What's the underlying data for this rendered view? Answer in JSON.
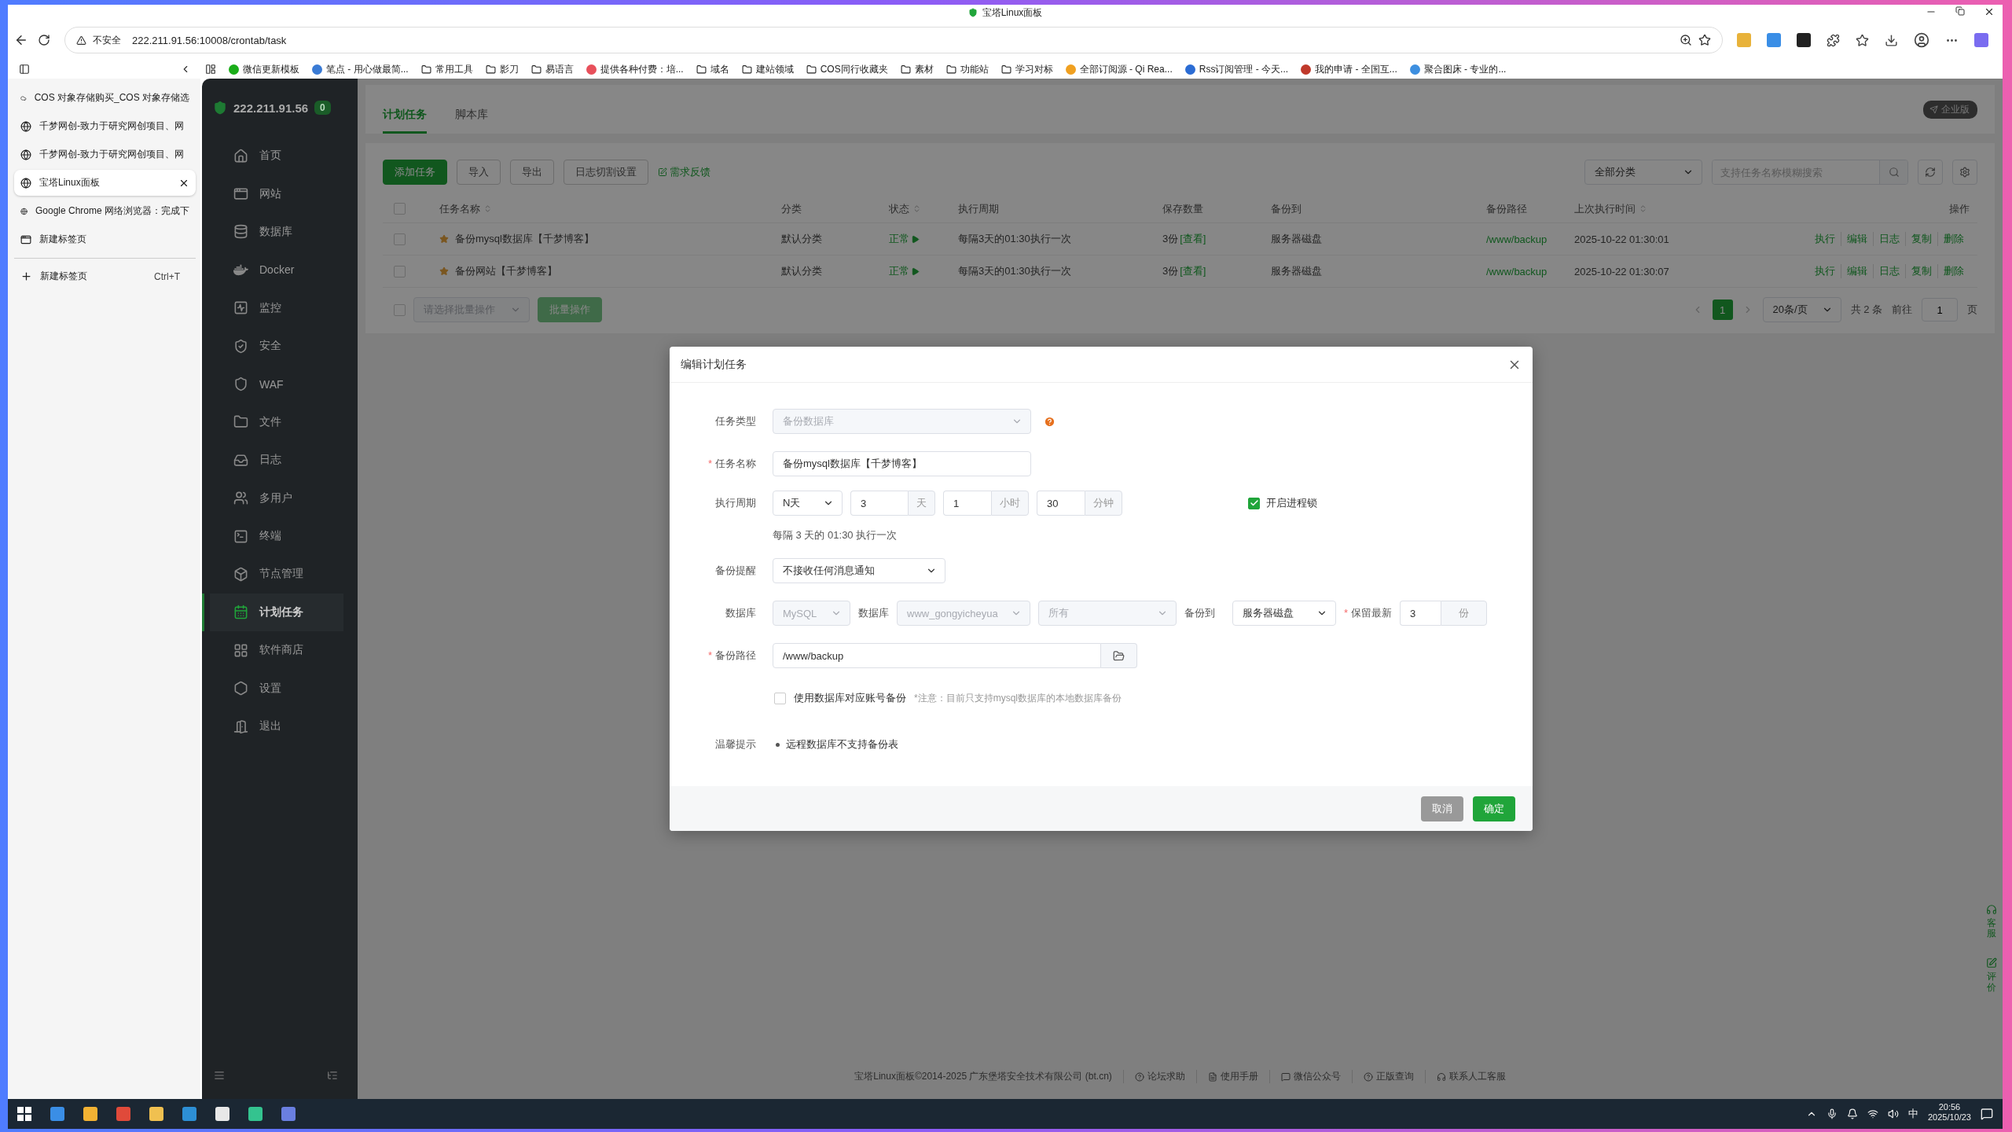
{
  "browser": {
    "title": "宝塔Linux面板",
    "security_label": "不安全",
    "url": "222.211.91.56:10008/crontab/task",
    "bookmarks": [
      {
        "kind": "site",
        "label": "微信更新模板",
        "color": "#1aad19"
      },
      {
        "kind": "site",
        "label": "笔点 - 用心做最简...",
        "color": "#3a7bd5"
      },
      {
        "kind": "folder",
        "label": "常用工具"
      },
      {
        "kind": "folder",
        "label": "影刀"
      },
      {
        "kind": "folder",
        "label": "易语言"
      },
      {
        "kind": "site",
        "label": "提供各种付费：培...",
        "color": "#e8505b"
      },
      {
        "kind": "folder",
        "label": "域名"
      },
      {
        "kind": "folder",
        "label": "建站领域"
      },
      {
        "kind": "folder",
        "label": "COS同行收藏夹"
      },
      {
        "kind": "folder",
        "label": "素材"
      },
      {
        "kind": "folder",
        "label": "功能站"
      },
      {
        "kind": "folder",
        "label": "学习对标"
      },
      {
        "kind": "site",
        "label": "全部订阅源 - Qi Rea...",
        "color": "#f0a020"
      },
      {
        "kind": "site",
        "label": "Rss订阅管理 - 今天...",
        "color": "#2b6cd4"
      },
      {
        "kind": "site",
        "label": "我的申请 - 全国互...",
        "color": "#c0392b"
      },
      {
        "kind": "site",
        "label": "聚合图床 - 专业的...",
        "color": "#3d8fe0"
      }
    ],
    "tabs": [
      {
        "title": "COS 对象存储购买_COS 对象存储选",
        "selected": false
      },
      {
        "title": "千梦网创-致力于研究网创项目、网",
        "selected": false
      },
      {
        "title": "千梦网创-致力于研究网创项目、网",
        "selected": false
      },
      {
        "title": "宝塔Linux面板",
        "selected": true
      },
      {
        "title": "Google Chrome 网络浏览器：完成下",
        "selected": false
      },
      {
        "title": "新建标签页",
        "selected": false
      }
    ],
    "new_tab": {
      "label": "新建标签页",
      "shortcut": "Ctrl+T"
    }
  },
  "panel": {
    "host": "222.211.91.56",
    "alert_count": "0",
    "nav": [
      {
        "label": "首页",
        "selected": false
      },
      {
        "label": "网站",
        "selected": false
      },
      {
        "label": "数据库",
        "selected": false
      },
      {
        "label": "Docker",
        "selected": false
      },
      {
        "label": "监控",
        "selected": false
      },
      {
        "label": "安全",
        "selected": false
      },
      {
        "label": "WAF",
        "selected": false
      },
      {
        "label": "文件",
        "selected": false
      },
      {
        "label": "日志",
        "selected": false
      },
      {
        "label": "多用户",
        "selected": false
      },
      {
        "label": "终端",
        "selected": false
      },
      {
        "label": "节点管理",
        "selected": false
      },
      {
        "label": "计划任务",
        "selected": true
      },
      {
        "label": "软件商店",
        "selected": false
      },
      {
        "label": "设置",
        "selected": false
      },
      {
        "label": "退出",
        "selected": false
      }
    ],
    "page_tabs": [
      {
        "label": "计划任务",
        "selected": true
      },
      {
        "label": "脚本库",
        "selected": false
      }
    ],
    "edition": "企业版",
    "toolbar": {
      "buttons": [
        {
          "kind": "primary",
          "label": "添加任务"
        },
        {
          "kind": "default",
          "label": "导入"
        },
        {
          "kind": "default",
          "label": "导出"
        },
        {
          "kind": "default",
          "label": "日志切割设置"
        }
      ],
      "feedback_link": "需求反馈",
      "category_filter": "全部分类",
      "search": {
        "placeholder": "支持任务名称模糊搜索"
      }
    },
    "table": {
      "select_all_checked": false,
      "columns": [
        {
          "label": "任务名称",
          "sortable": true
        },
        {
          "label": "分类",
          "sortable": false
        },
        {
          "label": "状态",
          "sortable": true
        },
        {
          "label": "执行周期",
          "sortable": false
        },
        {
          "label": "保存数量",
          "sortable": false
        },
        {
          "label": "备份到",
          "sortable": false
        },
        {
          "label": "备份路径",
          "sortable": false
        },
        {
          "label": "上次执行时间",
          "sortable": true
        },
        {
          "label": "操作",
          "sortable": false
        }
      ],
      "rows": [
        {
          "checked": false,
          "starred": true,
          "name": "备份mysql数据库【千梦博客】",
          "category": "默认分类",
          "status": "正常",
          "cycle": "每隔3天的01:30执行一次",
          "count": "3份",
          "count_link": "[查看]",
          "destination": "服务器磁盘",
          "path": "/www/backup",
          "last_run": "2025-10-22 01:30:01",
          "actions": [
            "执行",
            "编辑",
            "日志",
            "复制",
            "删除"
          ]
        },
        {
          "checked": false,
          "starred": true,
          "name": "备份网站【千梦博客】",
          "category": "默认分类",
          "status": "正常",
          "cycle": "每隔3天的01:30执行一次",
          "count": "3份",
          "count_link": "[查看]",
          "destination": "服务器磁盘",
          "path": "/www/backup",
          "last_run": "2025-10-22 01:30:07",
          "actions": [
            "执行",
            "编辑",
            "日志",
            "复制",
            "删除"
          ]
        }
      ]
    },
    "batch": {
      "checked": false,
      "placeholder": "请选择批量操作",
      "button": "批量操作"
    },
    "pagination": {
      "pages": [
        {
          "label": "1",
          "selected": true
        }
      ],
      "page_size": "20条/页",
      "total": "共 2 条",
      "goto_label": "前往",
      "goto_value": "1",
      "goto_suffix": "页"
    },
    "footer": {
      "copyright": "宝塔Linux面板©2014-2025 广东堡塔安全技术有限公司 (bt.cn)",
      "links": [
        "论坛求助",
        "使用手册",
        "微信公众号",
        "正版查询",
        "联系人工客服"
      ]
    },
    "side_float": [
      "客服",
      "评价"
    ]
  },
  "dialog": {
    "title": "编辑计划任务",
    "task_type": {
      "label": "任务类型",
      "value": "备份数据库",
      "disabled": true
    },
    "task_name": {
      "label": "任务名称",
      "required_mark": "*",
      "value": "备份mysql数据库【千梦博客】"
    },
    "schedule": {
      "label": "执行周期",
      "mode": "N天",
      "fields": [
        {
          "value": "3",
          "unit": "天"
        },
        {
          "value": "1",
          "unit": "小时"
        },
        {
          "value": "30",
          "unit": "分钟"
        }
      ],
      "lock": {
        "label": "开启进程锁",
        "checked": true
      },
      "summary": "每隔 3 天的 01:30 执行一次"
    },
    "notify": {
      "label": "备份提醒",
      "value": "不接收任何消息通知"
    },
    "database": {
      "label": "数据库",
      "engine": {
        "value": "MySQL",
        "disabled": true
      },
      "db_label": "数据库",
      "db": {
        "value": "www_gongyicheyua",
        "disabled": true
      },
      "tables": {
        "value": "所有",
        "disabled": true
      },
      "target_label": "备份到",
      "target": {
        "value": "服务器磁盘",
        "disabled": false
      },
      "keep_label": "保留最新",
      "keep_mark": "*",
      "keep": {
        "value": "3",
        "unit": "份"
      }
    },
    "path": {
      "label": "备份路径",
      "required_mark": "*",
      "value": "/www/backup"
    },
    "account_backup": {
      "label": "使用数据库对应账号备份",
      "checked": false,
      "note": "*注意：目前只支持mysql数据库的本地数据库备份"
    },
    "tips": {
      "label": "温馨提示",
      "items": [
        "远程数据库不支持备份表"
      ]
    },
    "buttons": [
      {
        "kind": "cancel",
        "label": "取消"
      },
      {
        "kind": "confirm",
        "label": "确定"
      }
    ]
  },
  "taskbar": {
    "ime": "中",
    "time": "20:56",
    "date": "2025/10/23"
  }
}
